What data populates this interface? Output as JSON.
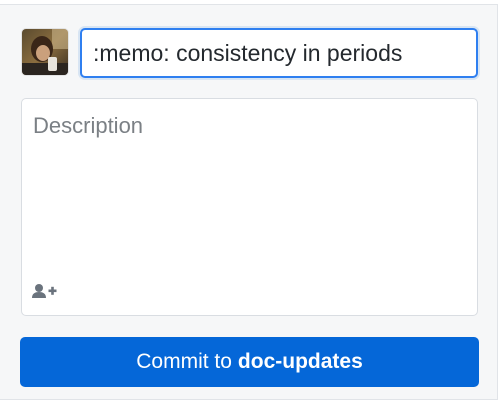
{
  "commit_form": {
    "avatar_icon": "user-avatar",
    "summary": {
      "value": ":memo: consistency in periods"
    },
    "description": {
      "placeholder": "Description",
      "value": ""
    },
    "coauthor_icon": "person-add-icon",
    "commit_button": {
      "prefix": "Commit to",
      "branch": "doc-updates"
    },
    "colors": {
      "accent": "#0567d8",
      "focus_border": "#2f7ff0",
      "panel_background": "#f6f7f8"
    }
  }
}
